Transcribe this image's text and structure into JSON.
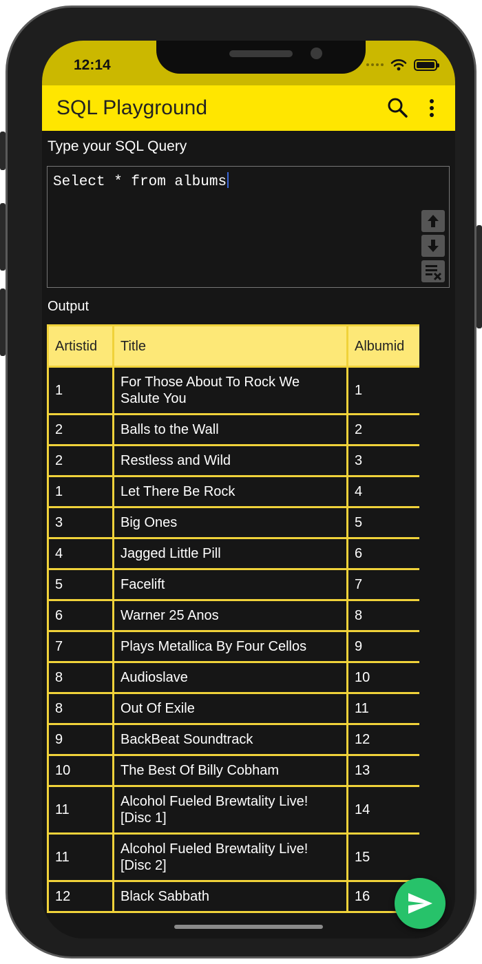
{
  "status_bar": {
    "time": "12:14"
  },
  "app_bar": {
    "title": "SQL Playground"
  },
  "query": {
    "label": "Type your SQL Query",
    "text": "Select * from albums"
  },
  "output": {
    "label": "Output",
    "columns": [
      "Artistid",
      "Title",
      "Albumid"
    ],
    "rows": [
      [
        "1",
        "For Those About To Rock We Salute You",
        "1"
      ],
      [
        "2",
        "Balls to the Wall",
        "2"
      ],
      [
        "2",
        "Restless and Wild",
        "3"
      ],
      [
        "1",
        "Let There Be Rock",
        "4"
      ],
      [
        "3",
        "Big Ones",
        "5"
      ],
      [
        "4",
        "Jagged Little Pill",
        "6"
      ],
      [
        "5",
        "Facelift",
        "7"
      ],
      [
        "6",
        "Warner 25 Anos",
        "8"
      ],
      [
        "7",
        "Plays Metallica By Four Cellos",
        "9"
      ],
      [
        "8",
        "Audioslave",
        "10"
      ],
      [
        "8",
        "Out Of Exile",
        "11"
      ],
      [
        "9",
        "BackBeat Soundtrack",
        "12"
      ],
      [
        "10",
        "The Best Of Billy Cobham",
        "13"
      ],
      [
        "11",
        "Alcohol Fueled Brewtality Live! [Disc 1]",
        "14"
      ],
      [
        "11",
        "Alcohol Fueled Brewtality Live! [Disc 2]",
        "15"
      ],
      [
        "12",
        "Black Sabbath",
        "16"
      ]
    ]
  },
  "icons": {
    "search": "search-icon",
    "more": "more-vert-icon",
    "history_up": "arrow-up-icon",
    "history_down": "arrow-down-icon",
    "clear": "clear-query-icon",
    "run": "send-icon"
  },
  "colors": {
    "app_bar": "#ffe600",
    "status_bar": "#cbb800",
    "table_border": "#f0d23a",
    "table_header": "#fde877",
    "fab": "#27c26a",
    "background": "#161616"
  }
}
